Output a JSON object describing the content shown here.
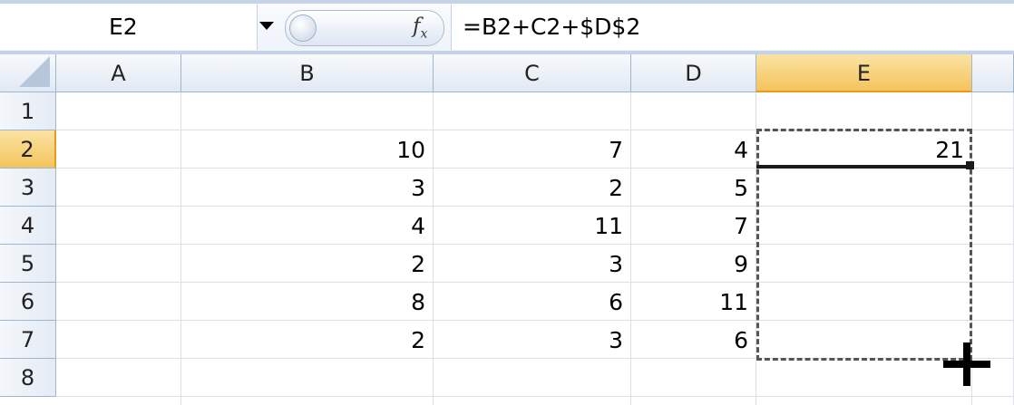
{
  "formula_bar": {
    "name_box": "E2",
    "fx_label": "fx",
    "formula": "=B2+C2+$D$2"
  },
  "columns": [
    "A",
    "B",
    "C",
    "D",
    "E"
  ],
  "rows": [
    "1",
    "2",
    "3",
    "4",
    "5",
    "6",
    "7",
    "8"
  ],
  "selected_cell": "E2",
  "cells": {
    "B": [
      "",
      "10",
      "3",
      "4",
      "2",
      "8",
      "2",
      ""
    ],
    "C": [
      "",
      "7",
      "2",
      "11",
      "3",
      "6",
      "3",
      ""
    ],
    "D": [
      "",
      "4",
      "5",
      "7",
      "9",
      "11",
      "6",
      ""
    ],
    "E": [
      "",
      "21",
      "",
      "",
      "",
      "",
      "",
      ""
    ]
  },
  "colors": {
    "header_selected": "#f4c45c",
    "header": "#e1e9f4",
    "gridline": "#d9e0ea"
  }
}
